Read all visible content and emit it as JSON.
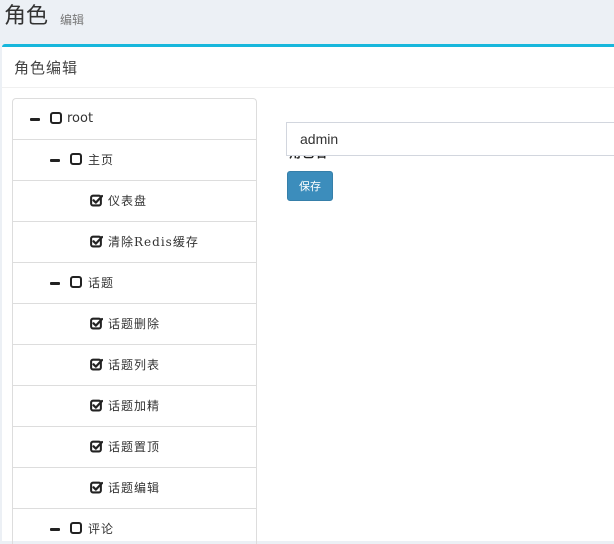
{
  "header": {
    "title": "角色",
    "subtitle": "编辑"
  },
  "box": {
    "title": "角色编辑"
  },
  "tree": [
    {
      "label": "root",
      "level": 0,
      "state": "unchecked",
      "expanded": true
    },
    {
      "label": "主页",
      "level": 1,
      "state": "unchecked",
      "expanded": true
    },
    {
      "label": "仪表盘",
      "level": 2,
      "state": "checked"
    },
    {
      "label": "清除Redis缓存",
      "level": 2,
      "state": "checked"
    },
    {
      "label": "话题",
      "level": 1,
      "state": "unchecked",
      "expanded": true
    },
    {
      "label": "话题删除",
      "level": 2,
      "state": "checked"
    },
    {
      "label": "话题列表",
      "level": 2,
      "state": "checked"
    },
    {
      "label": "话题加精",
      "level": 2,
      "state": "checked"
    },
    {
      "label": "话题置顶",
      "level": 2,
      "state": "checked"
    },
    {
      "label": "话题编辑",
      "level": 2,
      "state": "checked"
    },
    {
      "label": "评论",
      "level": 1,
      "state": "unchecked",
      "expanded": true
    }
  ],
  "form": {
    "role_name_label": "角色名",
    "role_name_value": "admin",
    "save_label": "保存"
  },
  "colors": {
    "accent": "#17b7dc",
    "primary_button": "#3c8dbc"
  }
}
